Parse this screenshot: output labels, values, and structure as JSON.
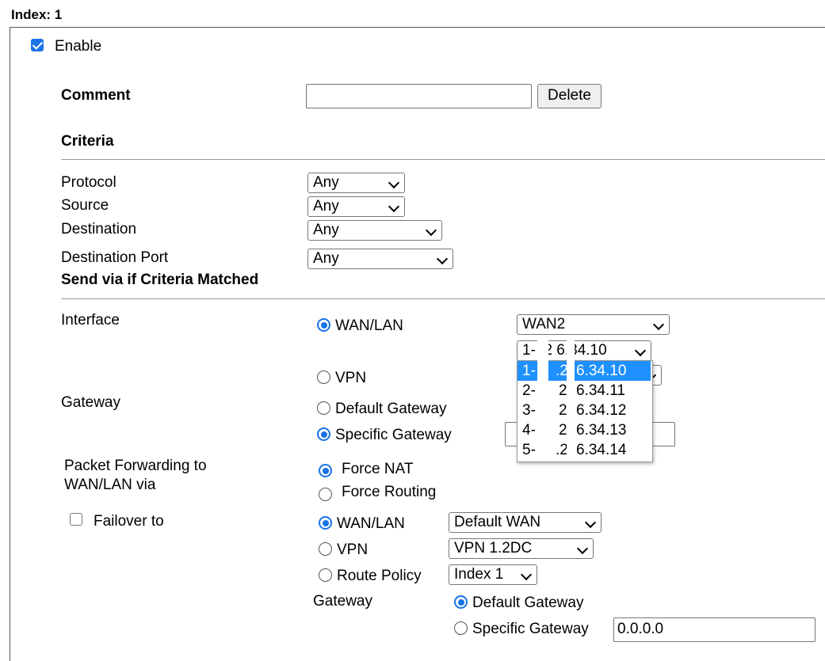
{
  "index_label": "Index: 1",
  "enable": {
    "label": "Enable",
    "checked": true
  },
  "comment": {
    "label": "Comment",
    "value": "",
    "delete_label": "Delete"
  },
  "criteria": {
    "heading": "Criteria",
    "protocol": {
      "label": "Protocol",
      "value": "Any"
    },
    "source": {
      "label": "Source",
      "value": "Any"
    },
    "destination": {
      "label": "Destination",
      "value": "Any"
    },
    "destination_port": {
      "label": "Destination Port",
      "value": "Any"
    }
  },
  "send_via": {
    "heading": "Send via if Criteria Matched",
    "interface_label": "Interface",
    "wan_lan": {
      "label": "WAN/LAN",
      "selected": true,
      "value": "WAN2"
    },
    "ip_select": {
      "value": "1-  .2  6.34.10"
    },
    "ip_options": [
      {
        "index": "1-",
        "mid": ".2",
        "ip": "6.34.10",
        "highlighted": true
      },
      {
        "index": "2-",
        "mid": "2",
        "ip": "6.34.11",
        "highlighted": false
      },
      {
        "index": "3-",
        "mid": "2",
        "ip": "6.34.12",
        "highlighted": false
      },
      {
        "index": "4-",
        "mid": "2",
        "ip": "6.34.13",
        "highlighted": false
      },
      {
        "index": "5-",
        "mid": ".2",
        "ip": "6.34.14",
        "highlighted": false
      }
    ],
    "vpn": {
      "label": "VPN",
      "selected": false
    },
    "gateway_label": "Gateway",
    "default_gateway": {
      "label": "Default Gateway",
      "selected": false
    },
    "specific_gateway": {
      "label": "Specific Gateway",
      "selected": true,
      "value": ""
    }
  },
  "packet_forwarding": {
    "label_line1": "Packet Forwarding to",
    "label_line2": "WAN/LAN via",
    "force_nat": {
      "label": "Force NAT",
      "selected": true
    },
    "force_routing": {
      "label": "Force Routing",
      "selected": false
    }
  },
  "failover": {
    "label": "Failover to",
    "checked": false,
    "wan_lan": {
      "label": "WAN/LAN",
      "selected": true,
      "value": "Default WAN"
    },
    "vpn": {
      "label": "VPN",
      "selected": false,
      "value": "VPN 1.2DC"
    },
    "route_policy": {
      "label": "Route Policy",
      "selected": false,
      "value": "Index 1"
    },
    "gateway_label": "Gateway",
    "default_gateway": {
      "label": "Default Gateway",
      "selected": true
    },
    "specific_gateway": {
      "label": "Specific Gateway",
      "selected": false,
      "value": "0.0.0.0"
    }
  }
}
